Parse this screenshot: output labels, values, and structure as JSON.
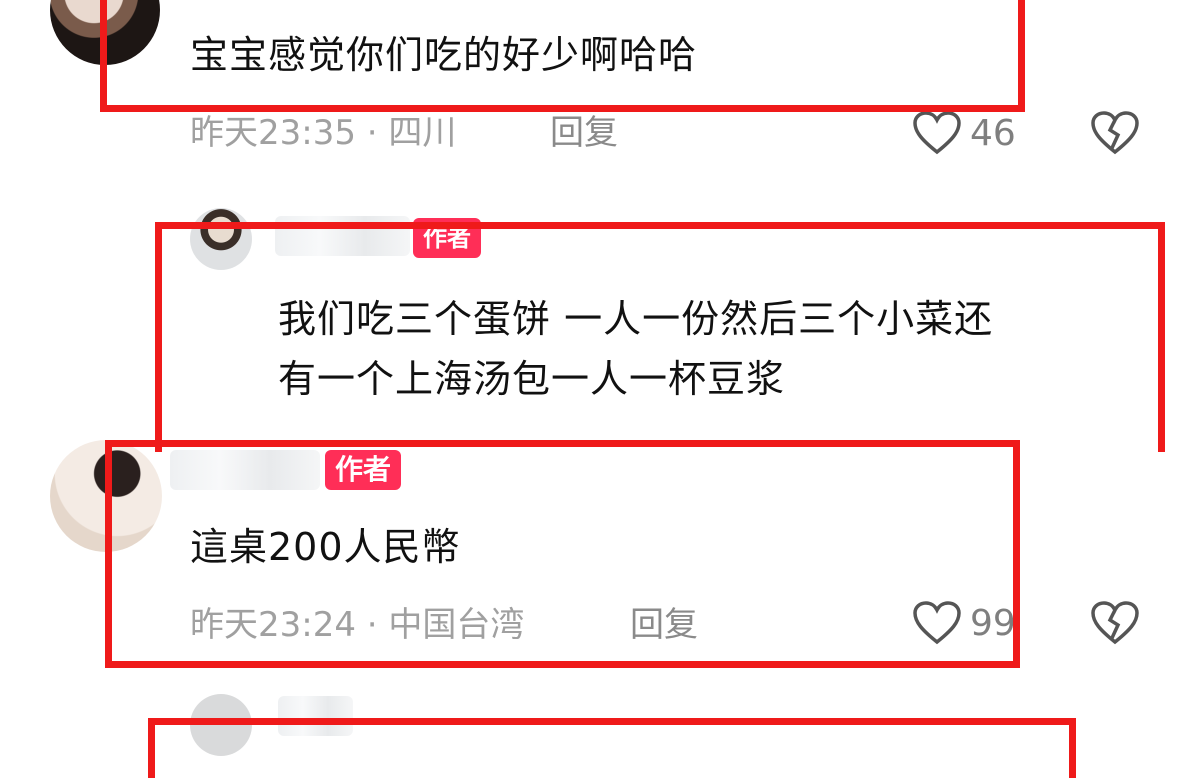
{
  "comments": [
    {
      "text": "宝宝感觉你们吃的好少啊哈哈",
      "time": "昨天23:35",
      "location": "四川",
      "reply_label": "回复",
      "likes": "46"
    },
    {
      "badge": "作者",
      "text_line1": "我们吃三个蛋饼 一人一份然后三个小菜还",
      "text_line2": "有一个上海汤包一人一杯豆浆"
    },
    {
      "badge": "作者",
      "text": "這桌200人民幣",
      "time": "昨天23:24",
      "location": "中国台湾",
      "reply_label": "回复",
      "likes": "99"
    }
  ],
  "separator": "·",
  "colors": {
    "highlight": "#ef1a1a",
    "badge": "#ff2e57"
  },
  "icons": [
    "heart-icon",
    "broken-heart-icon"
  ]
}
